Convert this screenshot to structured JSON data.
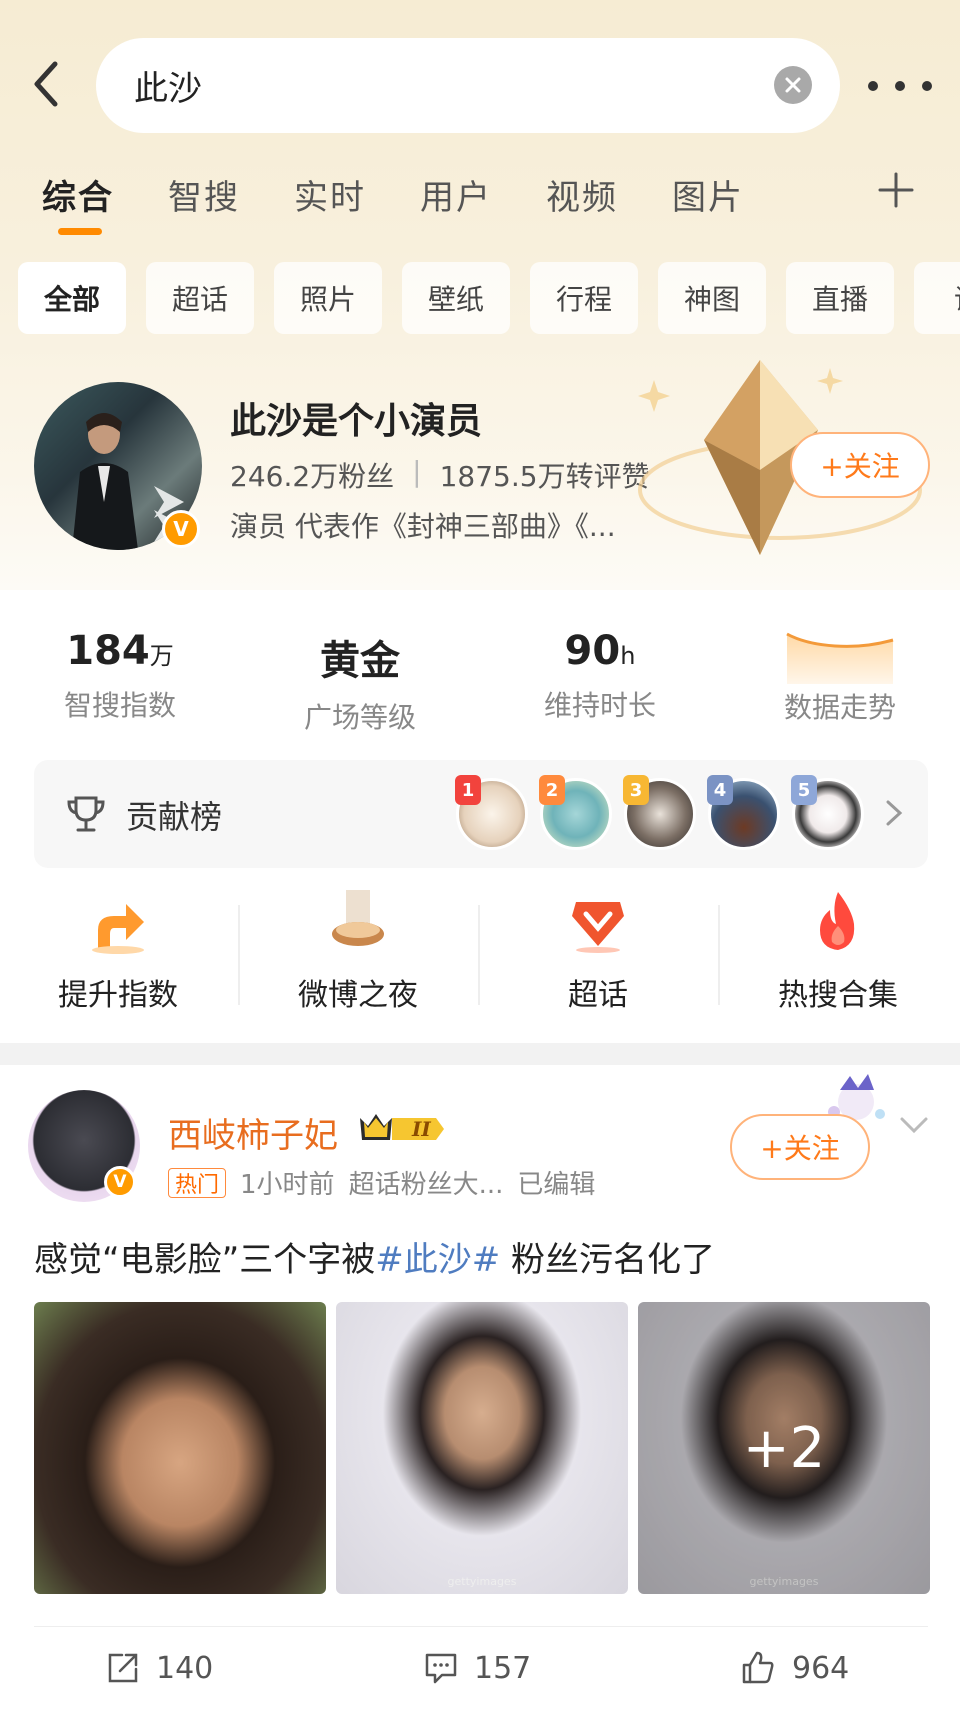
{
  "search": {
    "query": "此沙"
  },
  "tabs": [
    "综合",
    "智搜",
    "实时",
    "用户",
    "视频",
    "图片"
  ],
  "chips": [
    "全部",
    "超话",
    "照片",
    "壁纸",
    "行程",
    "神图",
    "直播",
    "话"
  ],
  "profile": {
    "name": "此沙是个小演员",
    "followers": "246.2万粉丝",
    "interactions": "1875.5万转评赞",
    "desc": "演员 代表作《封神三部曲》《...",
    "follow_label": "+关注",
    "verify_badge": "V"
  },
  "metrics": [
    {
      "value": "184",
      "unit": "万",
      "label": "智搜指数"
    },
    {
      "value": "黄金",
      "unit": "",
      "label": "广场等级"
    },
    {
      "value": "90",
      "unit": "h",
      "label": "维持时长"
    },
    {
      "value": "",
      "unit": "",
      "label": "数据走势"
    }
  ],
  "contribution": {
    "label": "贡献榜",
    "ranks": [
      "1",
      "2",
      "3",
      "4",
      "5"
    ]
  },
  "quick_actions": [
    "提升指数",
    "微博之夜",
    "超话",
    "热搜合集"
  ],
  "post": {
    "user": "西岐柿子妃",
    "crown_level": "II",
    "hot_tag": "热门",
    "time": "1小时前",
    "source": "超话粉丝大...",
    "edited": "已编辑",
    "follow_label": "+关注",
    "text_before": "感觉“电影脸”三个字被",
    "hashtag": "#此沙#",
    "text_after": " 粉丝污名化了",
    "more_photos": "+2",
    "watermark": "gettyimages",
    "reposts": "140",
    "comments": "157",
    "likes": "964"
  },
  "colors": {
    "accent": "#ff8a00",
    "hashtag": "#4f7cc0",
    "username": "#e86d1f"
  }
}
